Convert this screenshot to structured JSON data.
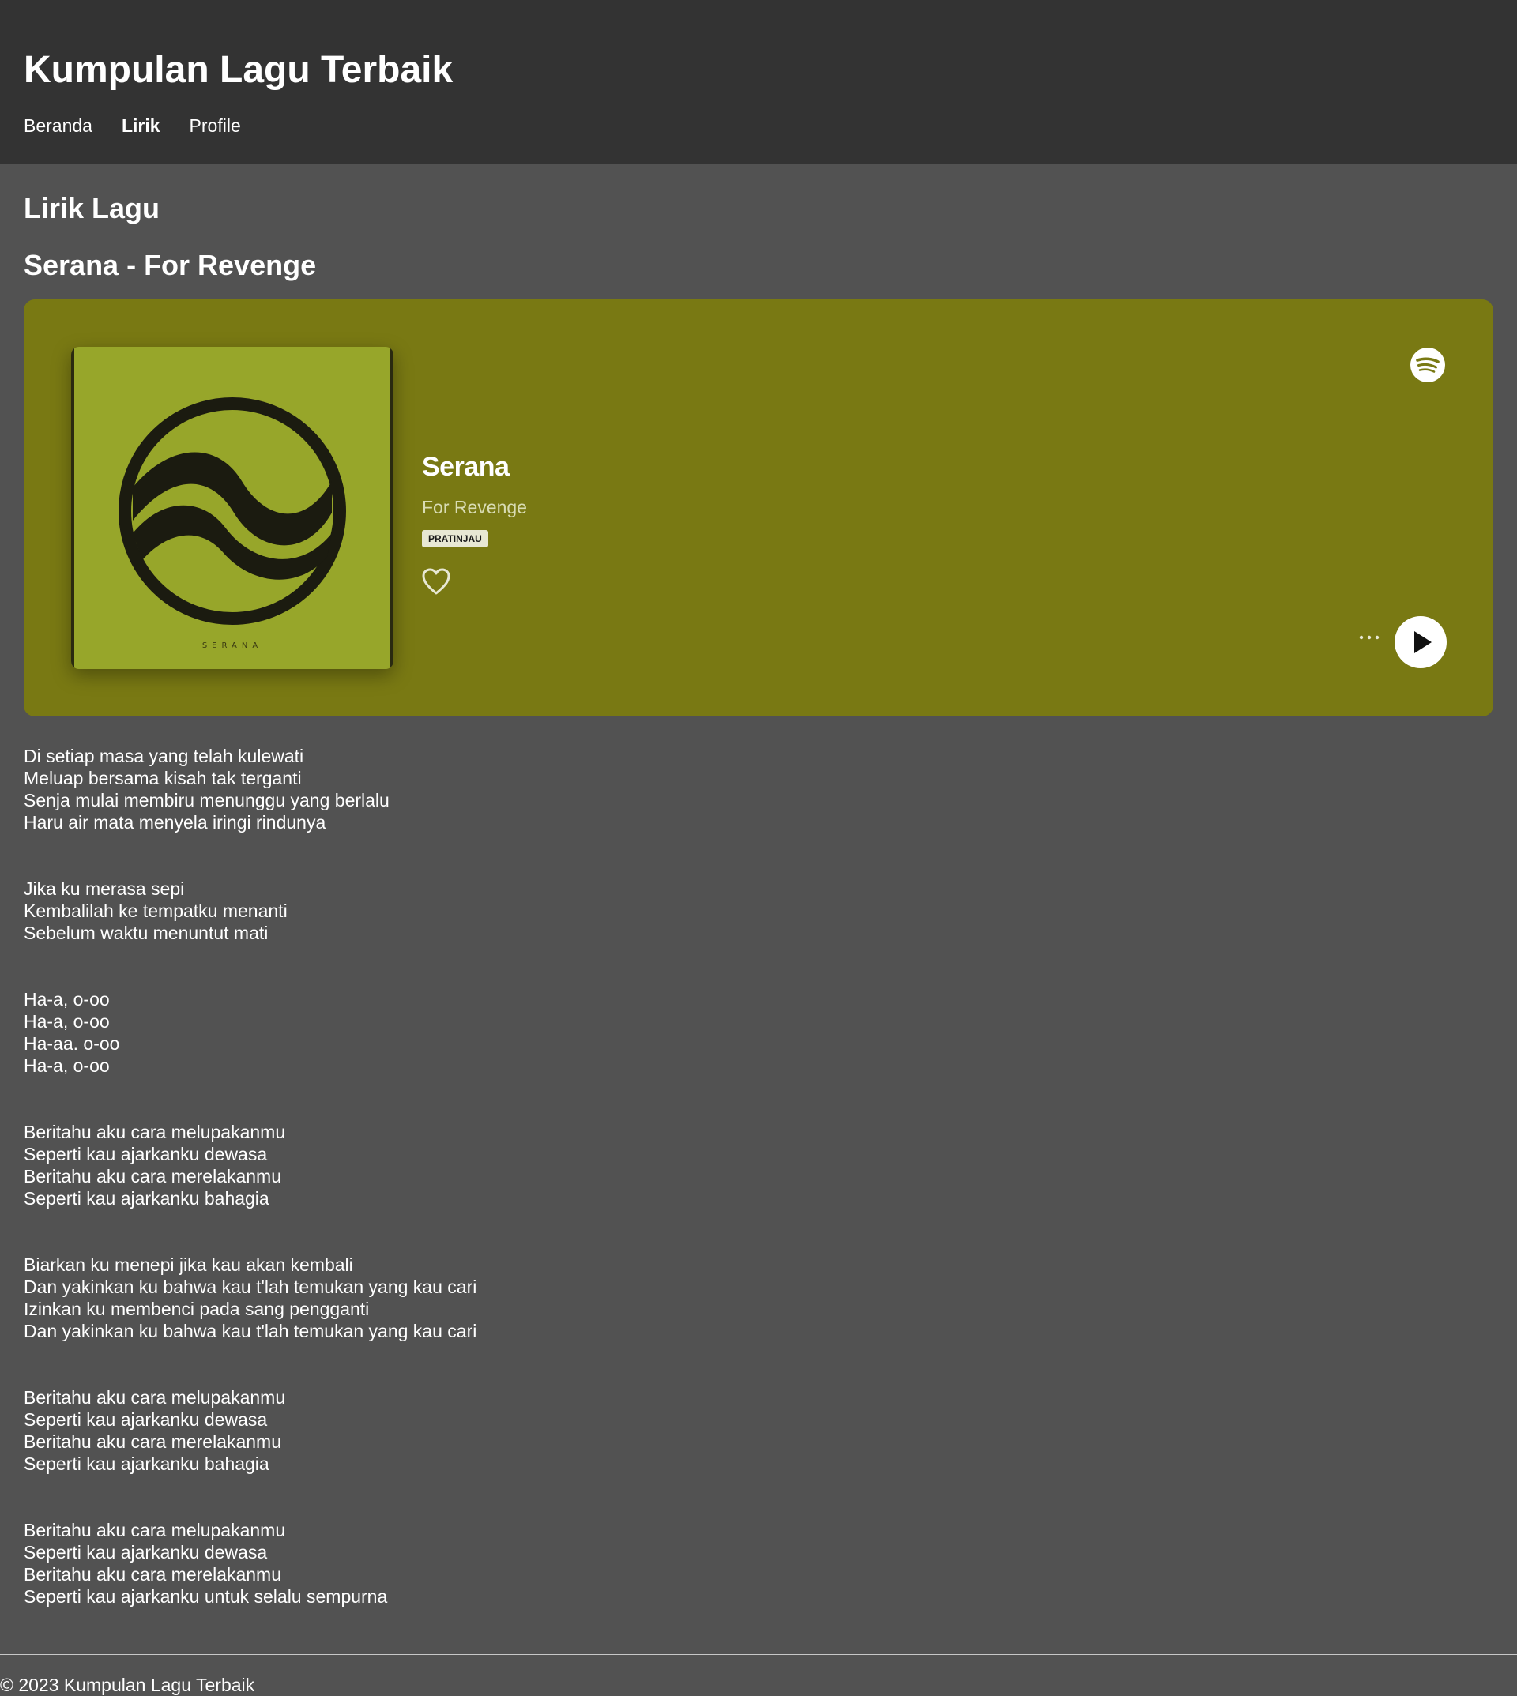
{
  "site": {
    "title": "Kumpulan Lagu Terbaik"
  },
  "nav": {
    "items": [
      {
        "label": "Beranda"
      },
      {
        "label": "Lirik"
      },
      {
        "label": "Profile"
      }
    ]
  },
  "main": {
    "page_title": "Lirik Lagu",
    "song_heading": "Serana - For Revenge"
  },
  "player": {
    "background_color": "#797913",
    "cover_text": "SERANA",
    "track_name": "Serana",
    "artist": "For Revenge",
    "badge": "PRATINJAU",
    "icons": {
      "like": "heart-icon",
      "brand": "spotify-icon",
      "more": "more-options-icon",
      "play": "play-icon"
    }
  },
  "lyrics": [
    "Di setiap masa yang telah kulewati\nMeluap bersama kisah tak terganti\nSenja mulai membiru menunggu yang berlalu\nHaru air mata menyela iringi rindunya",
    "Jika ku merasa sepi\nKembalilah ke tempatku menanti\nSebelum waktu menuntut mati",
    "Ha-a, o-oo\nHa-a, o-oo\nHa-aa. o-oo\nHa-a, o-oo",
    "Beritahu aku cara melupakanmu\nSeperti kau ajarkanku dewasa\nBeritahu aku cara merelakanmu\nSeperti kau ajarkanku bahagia",
    "Biarkan ku menepi jika kau akan kembali\nDan yakinkan ku bahwa kau t'lah temukan yang kau cari\nIzinkan ku membenci pada sang pengganti\nDan yakinkan ku bahwa kau t'lah temukan yang kau cari",
    "Beritahu aku cara melupakanmu\nSeperti kau ajarkanku dewasa\nBeritahu aku cara merelakanmu\nSeperti kau ajarkanku bahagia",
    "Beritahu aku cara melupakanmu\nSeperti kau ajarkanku dewasa\nBeritahu aku cara merelakanmu\nSeperti kau ajarkanku untuk selalu sempurna"
  ],
  "footer": {
    "text": "© 2023 Kumpulan Lagu Terbaik"
  }
}
